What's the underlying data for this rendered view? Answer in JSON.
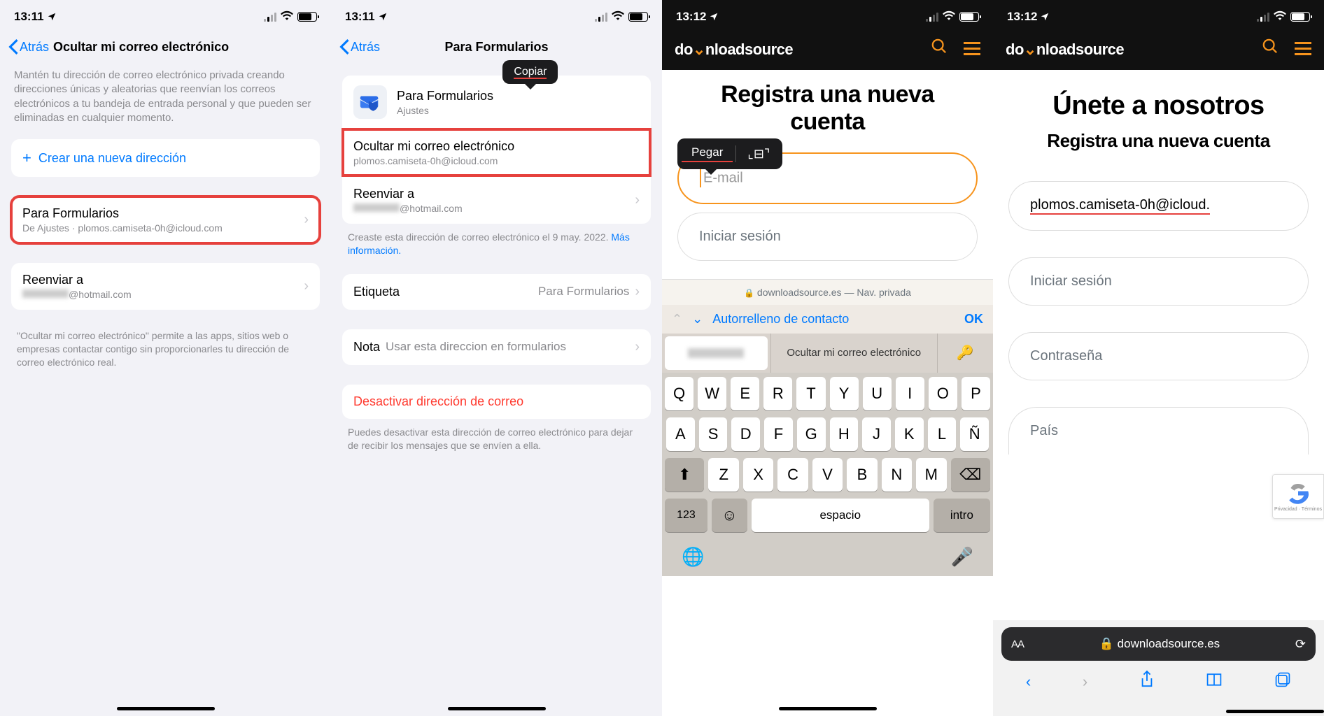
{
  "screen1": {
    "status": {
      "time": "13:11"
    },
    "nav": {
      "back": "Atrás",
      "title": "Ocultar mi correo electrónico"
    },
    "intro": "Mantén tu dirección de correo electrónico privada creando direcciones únicas y aleatorias que reenvían los correos electrónicos a tu bandeja de entrada personal y que pueden ser eliminadas en cualquier momento.",
    "create_new": "Crear una nueva dirección",
    "formularios": {
      "title": "Para Formularios",
      "sub": "De Ajustes · plomos.camiseta-0h@icloud.com"
    },
    "reenviar": {
      "title": "Reenviar a",
      "sub_suffix": "@hotmail.com"
    },
    "footer": "\"Ocultar mi correo electrónico\" permite a las apps, sitios web o empresas contactar contigo sin proporcionarles tu dirección de correo electrónico real."
  },
  "screen2": {
    "status": {
      "time": "13:11"
    },
    "nav": {
      "back": "Atrás",
      "title": "Para Formularios"
    },
    "app_row": {
      "title": "Para Formularios",
      "sub": "Ajustes"
    },
    "copiar": "Copiar",
    "ocultar": {
      "title": "Ocultar mi correo electrónico",
      "sub": "plomos.camiseta-0h@icloud.com"
    },
    "reenviar": {
      "title": "Reenviar a",
      "sub_suffix": "@hotmail.com"
    },
    "created_text": "Creaste esta dirección de correo electrónico el 9 may. 2022. ",
    "more_info": "Más información.",
    "etiqueta": {
      "label": "Etiqueta",
      "value": "Para Formularios"
    },
    "nota": {
      "label": "Nota",
      "value": "Usar esta direccion en formularios"
    },
    "deactivate": "Desactivar dirección de correo",
    "deactivate_footer": "Puedes desactivar esta dirección de correo electrónico para dejar de recibir los mensajes que se envíen a ella."
  },
  "screen3": {
    "status": {
      "time": "13:12"
    },
    "logo_pre": "do",
    "logo_post": "nloadsource",
    "title": "Registra una nueva cuenta",
    "paste": "Pegar",
    "email_placeholder": "E-mail",
    "login": "Iniciar sesión",
    "safari_host": "downloadsource.es",
    "safari_mode": " — Nav. privada",
    "autofill": "Autorrelleno de contacto",
    "ok": "OK",
    "suggest": "Ocultar mi correo electrónico",
    "keyboard": {
      "row1": [
        "Q",
        "W",
        "E",
        "R",
        "T",
        "Y",
        "U",
        "I",
        "O",
        "P"
      ],
      "row2": [
        "A",
        "S",
        "D",
        "F",
        "G",
        "H",
        "J",
        "K",
        "L",
        "Ñ"
      ],
      "row3": [
        "Z",
        "X",
        "C",
        "V",
        "B",
        "N",
        "M"
      ],
      "num": "123",
      "space": "espacio",
      "enter": "intro"
    }
  },
  "screen4": {
    "status": {
      "time": "13:12"
    },
    "logo_pre": "do",
    "logo_post": "nloadsource",
    "title_big": "Únete a nosotros",
    "subtitle": "Registra una nueva cuenta",
    "email_value": "plomos.camiseta-0h@icloud.",
    "login": "Iniciar sesión",
    "password": "Contraseña",
    "country": "País",
    "recaptcha": "Privacidad · Términos",
    "url": "downloadsource.es",
    "aa": "AA"
  }
}
